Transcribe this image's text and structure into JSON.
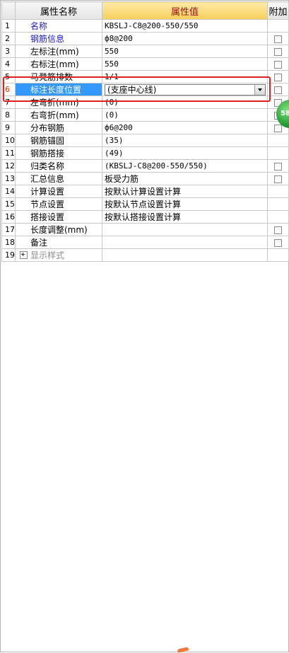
{
  "header": {
    "name_col": "属性名称",
    "value_col": "属性值",
    "extra_col": "附加"
  },
  "rows": [
    {
      "idx": "1",
      "name": "名称",
      "value": "KBSLJ-C8@200-550/550",
      "blue": true,
      "checkbox": false
    },
    {
      "idx": "2",
      "name": "钢筋信息",
      "value": "ф8@200",
      "blue": true,
      "checkbox": true
    },
    {
      "idx": "3",
      "name": "左标注(mm)",
      "value": "550",
      "checkbox": true
    },
    {
      "idx": "4",
      "name": "右标注(mm)",
      "value": "550",
      "checkbox": true
    },
    {
      "idx": "5",
      "name": "马凳筋排数",
      "value": "1/1",
      "checkbox": true
    },
    {
      "idx": "6",
      "name": "标注长度位置",
      "value": "(支座中心线)",
      "checkbox": true
    },
    {
      "idx": "7",
      "name": "左弯折(mm)",
      "value": "(0)",
      "checkbox": true
    },
    {
      "idx": "8",
      "name": "右弯折(mm)",
      "value": "(0)",
      "checkbox": true
    },
    {
      "idx": "9",
      "name": "分布钢筋",
      "value": "ф6@200",
      "checkbox": true
    },
    {
      "idx": "10",
      "name": "钢筋锚固",
      "value": "(35)",
      "checkbox": false
    },
    {
      "idx": "11",
      "name": "钢筋搭接",
      "value": "(49)",
      "checkbox": false
    },
    {
      "idx": "12",
      "name": "归类名称",
      "value": "(KBSLJ-C8@200-550/550)",
      "checkbox": true
    },
    {
      "idx": "13",
      "name": "汇总信息",
      "value": "板受力筋",
      "checkbox": true
    },
    {
      "idx": "14",
      "name": "计算设置",
      "value": "按默认计算设置计算",
      "checkbox": false
    },
    {
      "idx": "15",
      "name": "节点设置",
      "value": "按默认节点设置计算",
      "checkbox": false
    },
    {
      "idx": "16",
      "name": "搭接设置",
      "value": "按默认搭接设置计算",
      "checkbox": false
    },
    {
      "idx": "17",
      "name": "长度调整(mm)",
      "value": "",
      "checkbox": true
    },
    {
      "idx": "18",
      "name": "备注",
      "value": "",
      "checkbox": true
    },
    {
      "idx": "19",
      "name": "显示样式",
      "value": "",
      "checkbox": false
    }
  ],
  "badge": {
    "text": "58"
  },
  "colors": {
    "selected_bg": "#3399ff",
    "highlight_border": "#e0201e",
    "header_value_bg": "#f7cf5a"
  }
}
